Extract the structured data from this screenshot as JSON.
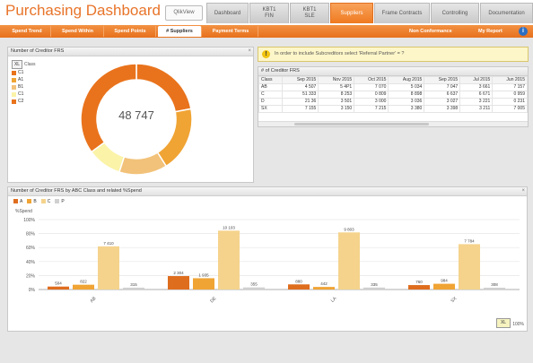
{
  "app": {
    "title": "Purchasing Dashboard",
    "logo_text": "QlikView",
    "tabs": [
      {
        "label": "Dashboard",
        "active": false
      },
      {
        "label": "KBT1\nFIN",
        "active": false
      },
      {
        "label": "KBT1\nSLE",
        "active": false
      },
      {
        "label": "Suppliers",
        "active": true
      },
      {
        "label": "Frame Contracts",
        "active": false
      },
      {
        "label": "Controlling",
        "active": false
      },
      {
        "label": "Documentation",
        "active": false
      }
    ]
  },
  "sheet_tabs": [
    {
      "label": "Spend Trend",
      "active": false
    },
    {
      "label": "Spend Within",
      "active": false
    },
    {
      "label": "Spend Points",
      "active": false
    },
    {
      "label": "# Suppliers",
      "active": true
    },
    {
      "label": "Payment Terms",
      "active": false
    }
  ],
  "right_links": {
    "non_conformance": "Non Conformance",
    "my_report": "My Report"
  },
  "donut_panel": {
    "title": "Number of Creditor FRS",
    "center_value": "48 747",
    "legend_title": "Class",
    "items": [
      {
        "label": "C1",
        "value": 22,
        "color": "#e9731c"
      },
      {
        "label": "A1",
        "value": 19,
        "color": "#f0a434"
      },
      {
        "label": "B1",
        "value": 14,
        "color": "#f2c27a"
      },
      {
        "label": "C1",
        "value": 10,
        "color": "#fbf3a8"
      },
      {
        "label": "C2",
        "value": 35,
        "color": "#e9731c"
      }
    ]
  },
  "note": {
    "text": "In order to include Subcreditors select 'Referral Partner' = ?"
  },
  "table_panel": {
    "title": "# of Creditor FRS",
    "col0": "Class",
    "headers": [
      "Sep 2015",
      "Nov 2015",
      "Oct 2015",
      "Aug 2015",
      "Sep 2015",
      "Jul 2015",
      "Jun 2015"
    ],
    "rows": [
      {
        "label": "AB",
        "cells": [
          "4 507",
          "5 4P1",
          "7 070",
          "5 034",
          "7 047",
          "3 661",
          "7 157"
        ]
      },
      {
        "label": "C",
        "cells": [
          "51 333",
          "8 253",
          "0 809",
          "8 898",
          "6 637",
          "6 671",
          "0 959"
        ]
      },
      {
        "label": "D",
        "cells": [
          "21 36",
          "3 501",
          "3 000",
          "3 036",
          "3 027",
          "3 221",
          "0 231"
        ]
      },
      {
        "label": "SX",
        "cells": [
          "7 155",
          "3 150",
          "7 215",
          "3 380",
          "3 398",
          "3 211",
          "7 005"
        ]
      }
    ]
  },
  "bar_panel": {
    "title": "Number of Creditor FRS by ABC Class and related %Spend",
    "legend": [
      {
        "label": "A",
        "color": "#df6d1e"
      },
      {
        "label": "B",
        "color": "#f0a434"
      },
      {
        "label": "C",
        "color": "#f5d38c"
      },
      {
        "label": "P",
        "color": "#d0d0d0"
      }
    ],
    "ylabel": "%Spend",
    "zoom_label": "100%"
  },
  "chart_data": {
    "type": "bar",
    "categories": [
      "AB",
      "DE",
      "LA",
      "SX"
    ],
    "series": [
      {
        "name": "A",
        "values": [
          504,
          2304,
          880,
          760
        ]
      },
      {
        "name": "B",
        "values": [
          822,
          1935,
          442,
          984
        ]
      },
      {
        "name": "C",
        "values": [
          7410,
          10103,
          9803,
          7784
        ]
      },
      {
        "name": "P",
        "values": [
          315,
          355,
          335,
          308
        ]
      }
    ],
    "value_labels": [
      [
        "504",
        "822",
        "7 410",
        "315"
      ],
      [
        "2 304",
        "1 935",
        "10 103",
        "355"
      ],
      [
        "880",
        "442",
        "9 803",
        "335"
      ],
      [
        "760",
        "984",
        "7 784",
        "308"
      ]
    ],
    "yticks": [
      "0%",
      "20%",
      "40%",
      "60%",
      "80%",
      "100%"
    ],
    "ylim": [
      0,
      12000
    ],
    "title": "Number of Creditor FRS by ABC Class and related %Spend",
    "xlabel": "",
    "ylabel": "%Spend",
    "legend": "top-left"
  }
}
